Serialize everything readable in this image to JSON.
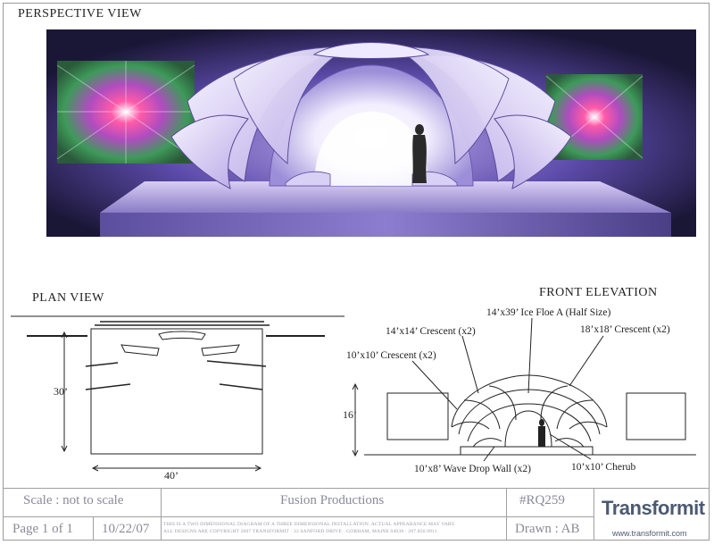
{
  "headings": {
    "perspective": "PERSPECTIVE VIEW",
    "plan": "PLAN VIEW",
    "front": "FRONT ELEVATION"
  },
  "plan": {
    "depth_label": "30’",
    "width_label": "40’"
  },
  "front": {
    "height_label": "16’",
    "callouts": {
      "ice_floe": "14’x39’ Ice Floe A (Half Size)",
      "crescent_14": "14’x14’ Crescent (x2)",
      "crescent_18": "18’x18’ Crescent (x2)",
      "crescent_10": "10’x10’ Crescent (x2)",
      "wave_drop": "10’x8’ Wave Drop Wall (x2)",
      "cherub": "10’x10’ Cherub"
    }
  },
  "title_block": {
    "scale": "Scale : not to scale",
    "client": "Fusion Productions",
    "job": "#RQ259",
    "page": "Page 1 of 1",
    "date": "10/22/07",
    "disclaimer_1": "THIS IS A TWO DIMENSIONAL DIAGRAM OF A THREE DIMENSIONAL INSTALLATION. ACTUAL APPEARANCE MAY VARY.",
    "disclaimer_2": "ALL DESIGNS ARE COPYRIGHT 2007 TRANSFORMIT · 33 SANFORD DRIVE · GORHAM, MAINE 04038 · 207.856.9911",
    "drawn": "Drawn : AB",
    "logo": "Transformit",
    "website": "www.transformit.com"
  },
  "colors": {
    "border": "#9a9a9a",
    "title_text": "#8a8a9a",
    "logo": "#4c5a72",
    "stage_dark": "#1c1a3a",
    "stage_purple": "#7a68c8",
    "glow": "#ffffff"
  }
}
